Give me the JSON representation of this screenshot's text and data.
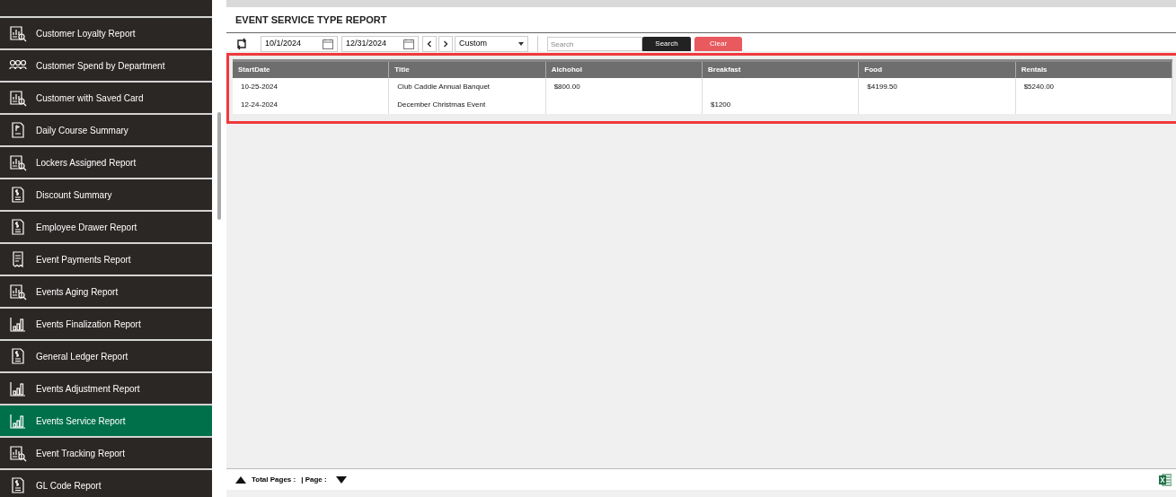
{
  "sidebar": {
    "items": [
      {
        "label": "Customer Loyalty Report",
        "kind": "analysis",
        "selected": false
      },
      {
        "label": "Customer Spend by Department",
        "kind": "people",
        "selected": false
      },
      {
        "label": "Customer with Saved Card",
        "kind": "analysis",
        "selected": false
      },
      {
        "label": "Daily Course Summary",
        "kind": "course",
        "selected": false
      },
      {
        "label": "Lockers Assigned Report",
        "kind": "analysis",
        "selected": false
      },
      {
        "label": "Discount Summary",
        "kind": "money",
        "selected": false
      },
      {
        "label": "Employee Drawer Report",
        "kind": "money",
        "selected": false
      },
      {
        "label": "Event Payments Report",
        "kind": "receipt",
        "selected": false
      },
      {
        "label": "Events Aging Report",
        "kind": "analysis",
        "selected": false
      },
      {
        "label": "Events Finalization Report",
        "kind": "chart",
        "selected": false
      },
      {
        "label": "General Ledger Report",
        "kind": "money",
        "selected": false
      },
      {
        "label": "Events Adjustment Report",
        "kind": "chart",
        "selected": false
      },
      {
        "label": "Events Service Report",
        "kind": "chart",
        "selected": true
      },
      {
        "label": "Event Tracking Report",
        "kind": "analysis",
        "selected": false
      },
      {
        "label": "GL Code Report",
        "kind": "money",
        "selected": false
      }
    ]
  },
  "report": {
    "title": "EVENT SERVICE TYPE REPORT",
    "toolbar": {
      "start_date": "10/1/2024",
      "end_date": "12/31/2024",
      "range": "Custom",
      "search": {
        "placeholder": "Search"
      },
      "search_button": "Search",
      "clear_button": "Clear"
    },
    "table": {
      "columns": [
        "StartDate",
        "Title",
        "Alchohol",
        "Breakfast",
        "Food",
        "Rentals"
      ],
      "rows": [
        [
          "10-25-2024",
          "Club Caddie Annual Banquet",
          "$800.00",
          "",
          "$4199.50",
          "$5240.00"
        ],
        [
          "12-24-2024",
          "December Christmas Event",
          "",
          "$1200",
          "",
          ""
        ]
      ]
    }
  },
  "footer": {
    "total_pages": "Total Pages :",
    "page": "| Page :"
  }
}
